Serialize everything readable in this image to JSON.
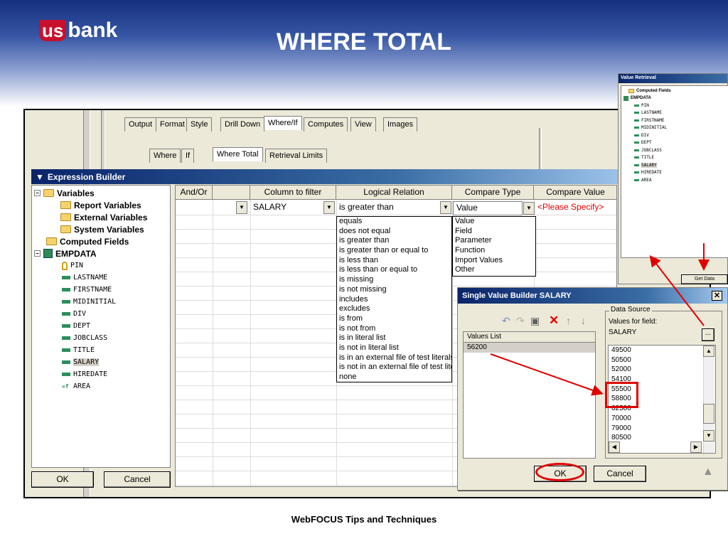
{
  "slide": {
    "brand_left": "us",
    "brand_right": "bank",
    "title": "WHERE TOTAL",
    "footer": "WebFOCUS Tips and Techniques"
  },
  "tabs_top": [
    "Output",
    "Format",
    "Style",
    "Drill Down",
    "Where/If",
    "Computes",
    "View",
    "Images"
  ],
  "tabs_sub": [
    "Where",
    "If",
    "Where Total",
    "Retrieval Limits"
  ],
  "expression_builder": {
    "title": "Expression Builder",
    "tree": {
      "variables": "Variables",
      "report_variables": "Report Variables",
      "external_variables": "External Variables",
      "system_variables": "System Variables",
      "computed_fields": "Computed Fields",
      "empdata": "EMPDATA",
      "fields": [
        "PIN",
        "LASTNAME",
        "FIRSTNAME",
        "MIDINITIAL",
        "DIV",
        "DEPT",
        "JOBCLASS",
        "TITLE",
        "SALARY",
        "HIREDATE",
        "AREA"
      ]
    },
    "ok": "OK",
    "cancel": "Cancel",
    "grid": {
      "headers": [
        "And/Or",
        "",
        "Column to filter",
        "Logical Relation",
        "Compare Type",
        "Compare Value"
      ],
      "row": {
        "column": "SALARY",
        "relation": "is greater than",
        "compare_type": "Value",
        "compare_value": "<Please Specify>"
      },
      "relation_options": [
        "equals",
        "does not equal",
        "is greater than",
        "is greater than or equal to",
        "is less than",
        "is less than or equal to",
        "is missing",
        "is not missing",
        "includes",
        "excludes",
        "is from",
        "is not from",
        "is in literal list",
        "is not in literal list",
        "is in an external file of test literals",
        "is not in an external file of test literals",
        "none"
      ],
      "type_options": [
        "Value",
        "Field",
        "Parameter",
        "Function",
        "Import Values",
        "Other"
      ]
    }
  },
  "value_retrieval": {
    "title": "Value Retrieval",
    "computed": "Computed Fields",
    "empdata": "EMPDATA",
    "fields": [
      "PIN",
      "LASTNAME",
      "FIRSTNAME",
      "MIDINITIAL",
      "DIV",
      "DEPT",
      "JOBCLASS",
      "TITLE",
      "SALARY",
      "HIREDATE",
      "AREA"
    ],
    "get_data": "Get Data"
  },
  "svb": {
    "title": "Single Value Builder SALARY",
    "values_list_header": "Values List",
    "values_list": [
      "56200"
    ],
    "data_source_label": "Data Source",
    "values_for_field": "Values for field:",
    "field": "SALARY",
    "browse": "...",
    "values": [
      "49500",
      "50500",
      "52000",
      "54100",
      "55500",
      "58800",
      "62500",
      "70000",
      "79000",
      "80500"
    ],
    "ok": "OK",
    "cancel": "Cancel"
  },
  "colors": {
    "annotation": "#e00000",
    "title_bar": "#0a246a",
    "slide_top": "#16307e"
  }
}
